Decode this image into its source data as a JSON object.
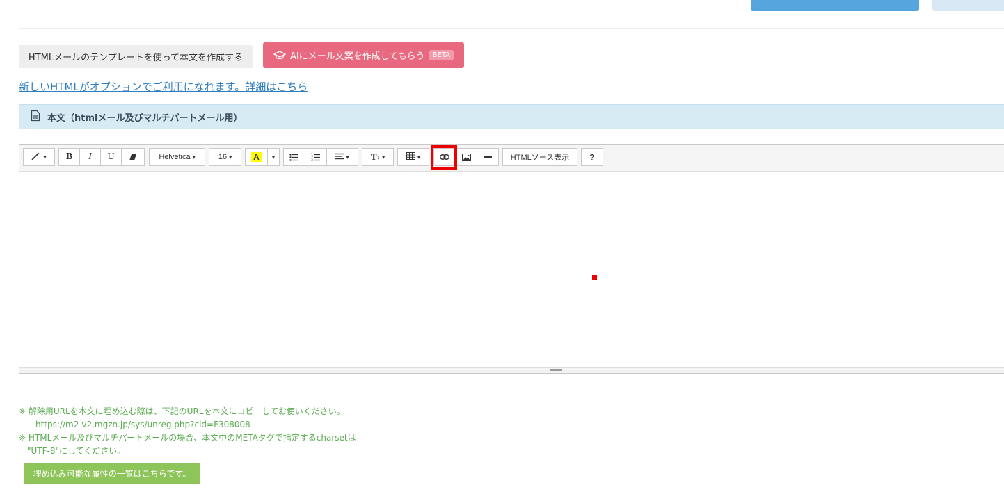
{
  "template_button": "HTMLメールのテンプレートを使って本文を作成する",
  "ai_button": {
    "label": "AIにメール文案を作成してもらう",
    "badge": "BETA",
    "color": "#e8697f"
  },
  "option_link": "新しいHTMLがオプションでご利用になれます。詳細はこちら",
  "section_title": "本文（htmlメール及びマルチパートメール用）",
  "toolbar": {
    "bold": "B",
    "italic": "I",
    "underline": "U",
    "font_name": "Helvetica",
    "font_size": "16",
    "color_letter": "A",
    "html_source": "HTMLソース表示",
    "help": "?",
    "text_size": "T"
  },
  "notes": {
    "line1": "※ 解除用URLを本文に埋め込む際は、下記のURLを本文にコピーしてお使いください。",
    "url": "https://m2-v2.mgzn.jp/sys/unreg.php?cid=F308008",
    "line2": "※ HTMLメール及びマルチパートメールの場合、本文中のMETAタグで指定するcharsetは",
    "line3": "\"UTF-8\"にしてください。"
  },
  "attributes_button": "埋め込み可能な属性の一覧はこちらです。",
  "colors": {
    "accent_blue": "#56a5df",
    "highlight": "#ee0000",
    "notes_green": "#5aab4f",
    "attr_button": "#8dc55a"
  }
}
